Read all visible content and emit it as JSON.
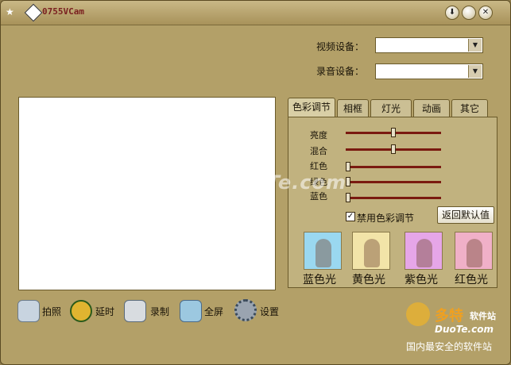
{
  "window": {
    "title": "0755VCam"
  },
  "devices": {
    "video_label": "视频设备：",
    "video_value": "",
    "audio_label": "录音设备：",
    "audio_value": ""
  },
  "tabs": [
    {
      "label": "色彩调节",
      "active": true
    },
    {
      "label": "相框",
      "active": false
    },
    {
      "label": "灯光",
      "active": false
    },
    {
      "label": "动画",
      "active": false
    },
    {
      "label": "其它",
      "active": false
    }
  ],
  "color_panel": {
    "sliders": [
      {
        "label": "亮度",
        "value": 0.5
      },
      {
        "label": "混合",
        "value": 0.5
      },
      {
        "label": "红色",
        "value": 0.0
      },
      {
        "label": "绿色",
        "value": 0.0
      },
      {
        "label": "蓝色",
        "value": 0.0
      }
    ],
    "disable_checkbox_label": "禁用色彩调节",
    "disable_checked": true,
    "reset_button_label": "返回默认值",
    "filters": [
      {
        "label": "蓝色光",
        "tint": "#9ad8f0"
      },
      {
        "label": "黄色光",
        "tint": "#f2e4a8"
      },
      {
        "label": "紫色光",
        "tint": "#e6a6e8"
      },
      {
        "label": "红色光",
        "tint": "#f0b0c8"
      }
    ]
  },
  "bottom_bar": [
    {
      "label": "拍照",
      "icon": "camera-icon"
    },
    {
      "label": "延时",
      "icon": "alarm-clock-icon"
    },
    {
      "label": "录制",
      "icon": "film-reel-icon"
    },
    {
      "label": "全屏",
      "icon": "monitor-icon"
    },
    {
      "label": "设置",
      "icon": "gear-icon"
    }
  ],
  "watermarks": {
    "center": "www.DuoTe.com",
    "logo_cn": "多特",
    "logo_suffix": "软件站",
    "logo_en": "DuoTe.com",
    "tagline": "国内最安全的软件站"
  }
}
